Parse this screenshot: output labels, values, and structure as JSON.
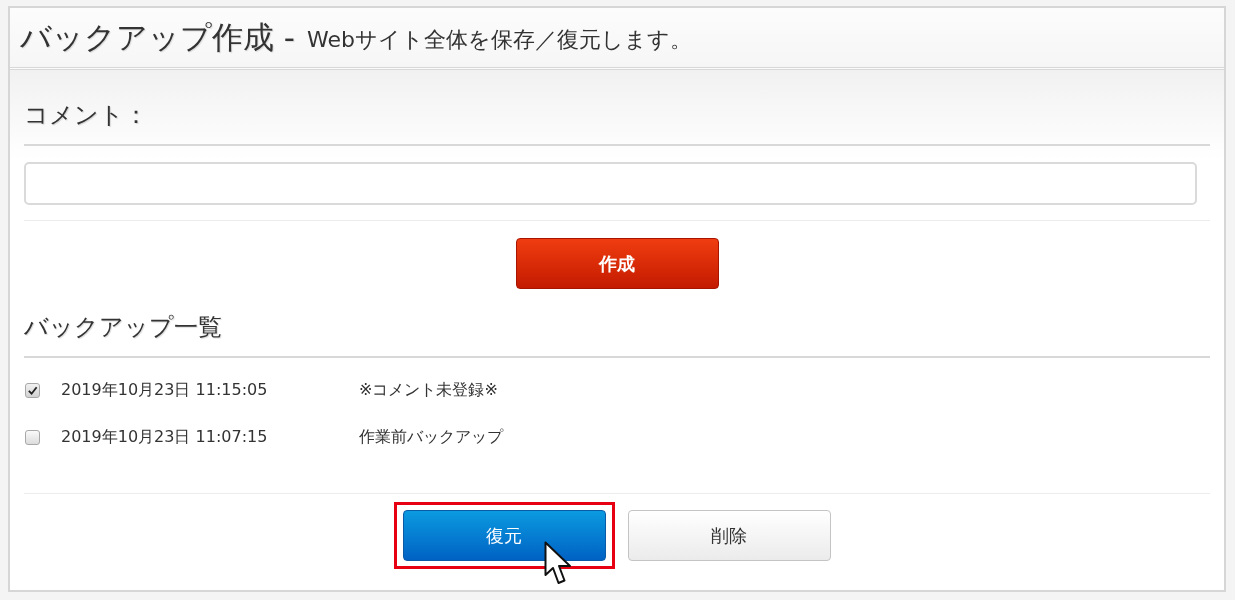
{
  "header": {
    "title": "バックアップ作成 -",
    "subtitle": "Webサイト全体を保存／復元します。"
  },
  "comment": {
    "label": "コメント："
  },
  "create_button": {
    "label": "作成"
  },
  "backups": {
    "title": "バックアップ一覧",
    "items": [
      {
        "date": "2019年10月23日 11:15:05",
        "comment": "※コメント未登録※",
        "checked": true
      },
      {
        "date": "2019年10月23日 11:07:15",
        "comment": "作業前バックアップ",
        "checked": false
      }
    ]
  },
  "actions": [
    {
      "label": "復元",
      "kind": "primary",
      "highlighted": true,
      "pointer": true
    },
    {
      "label": "削除",
      "kind": "secondary",
      "highlighted": false,
      "pointer": false
    }
  ]
}
